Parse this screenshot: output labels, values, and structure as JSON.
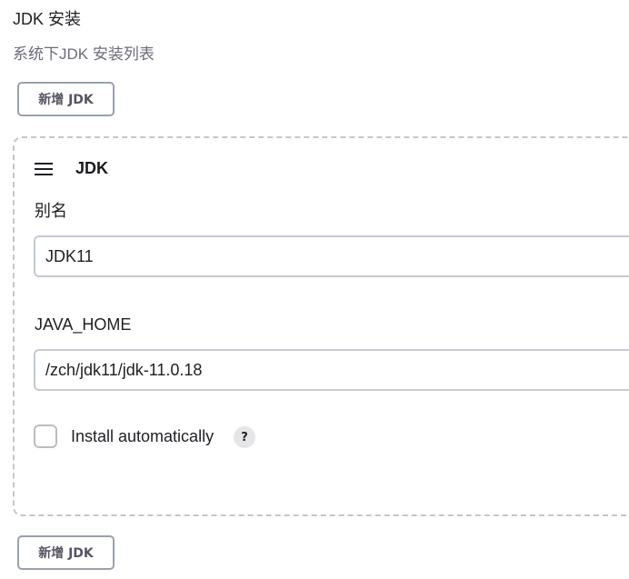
{
  "section": {
    "title": "JDK 安装",
    "description": "系统下JDK 安装列表"
  },
  "add_button_label": "新增 JDK",
  "jdk_entry": {
    "title": "JDK",
    "alias_label": "别名",
    "alias_value": "JDK11",
    "java_home_label": "JAVA_HOME",
    "java_home_value": "/zch/jdk11/jdk-11.0.18",
    "install_automatically_label": "Install automatically",
    "install_automatically_checked": false,
    "help_symbol": "?"
  },
  "icons": {
    "drag_handle": "hamburger-drag-icon",
    "help": "help-icon"
  }
}
